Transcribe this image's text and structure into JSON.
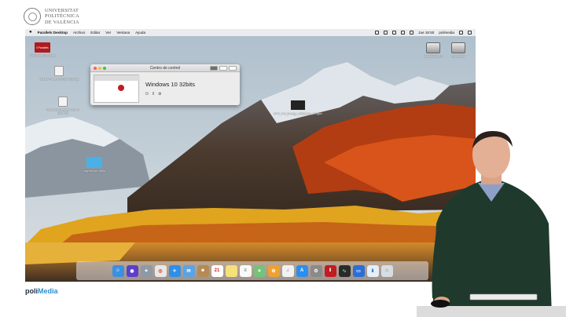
{
  "branding": {
    "university_line1": "UNIVERSITAT",
    "university_line2": "POLITÈCNICA",
    "university_line3": "DE VALÈNCIA",
    "footer_poli": "poli",
    "footer_media": "Media"
  },
  "menubar": {
    "app_name": "Parallels Desktop",
    "items": [
      "Archivo",
      "Editar",
      "Ver",
      "Ventana",
      "Ayuda"
    ],
    "clock": "Jue 16:50",
    "user": "polimedia"
  },
  "desktop_icons": [
    {
      "label": "Windows 10 32bits"
    },
    {
      "label": "Mobile Panel 8.0 (32-bit).dmg"
    },
    {
      "label": "Parallels Desktop 13.1.0 (3).dmg"
    },
    {
      "label": "UPV_Pol_Energy_Efficiency_v2.pptx"
    },
    {
      "label": "Macintosh HD"
    },
    {
      "label": "Mavericks"
    },
    {
      "label": "carpeta sin título"
    }
  ],
  "control_center": {
    "title": "Centro de control",
    "vm_name": "Windows 10 32bits"
  },
  "colors": {
    "close": "#fc605c",
    "minimize": "#fdbc40",
    "zoom": "#34c84a",
    "parallels_red": "#b1191f",
    "polimedia_blue": "#2e8fd0"
  },
  "dock_apps": [
    "finder-icon",
    "siri-icon",
    "launchpad-icon",
    "chrome-icon",
    "safari-icon",
    "mail-icon",
    "contacts-icon",
    "calendar-icon",
    "notes-icon",
    "reminders-icon",
    "maps-icon",
    "photos-icon",
    "itunes-icon",
    "appstore-icon",
    "preferences-icon",
    "parallels-icon",
    "activity-icon",
    "monitor-icon",
    "downloads-icon",
    "trash-icon"
  ]
}
